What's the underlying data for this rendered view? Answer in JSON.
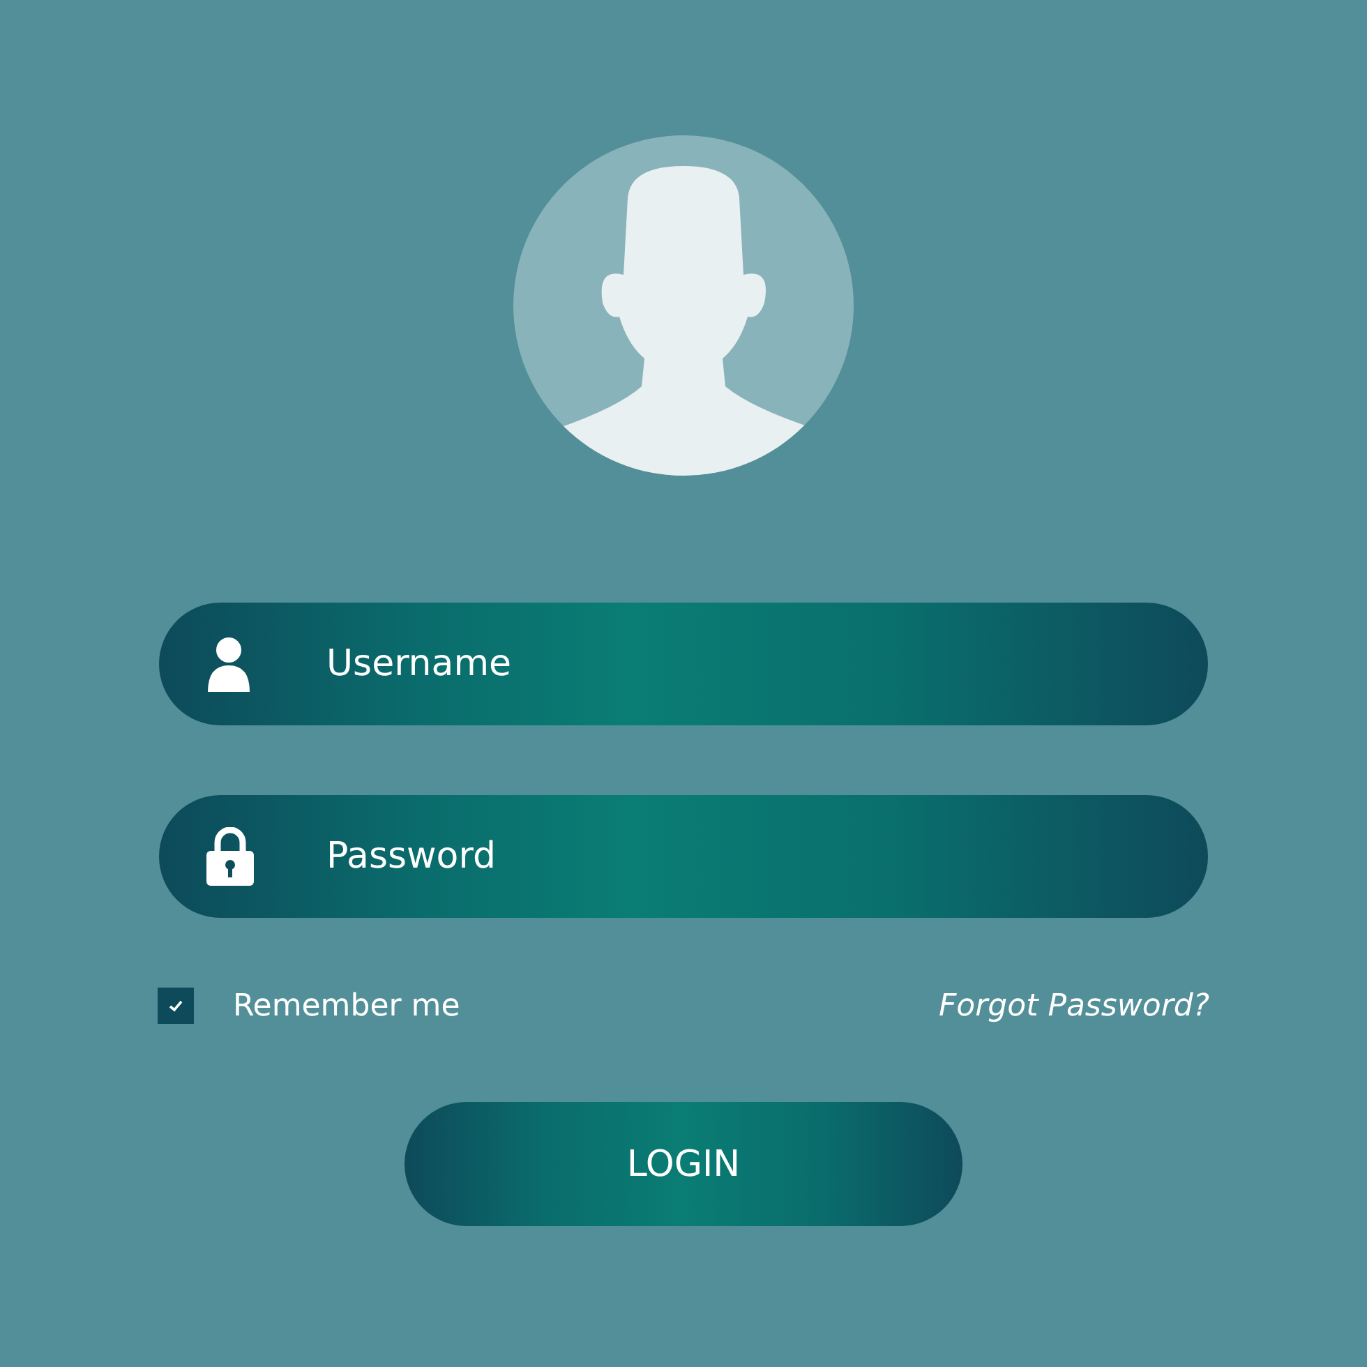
{
  "fields": [
    {
      "kind": "username",
      "placeholder": "Username"
    },
    {
      "kind": "password",
      "placeholder": "Password"
    }
  ],
  "remember": {
    "label": "Remember me",
    "checked": true
  },
  "forgot_link": "Forgot Password?",
  "login_button": "LOGIN"
}
